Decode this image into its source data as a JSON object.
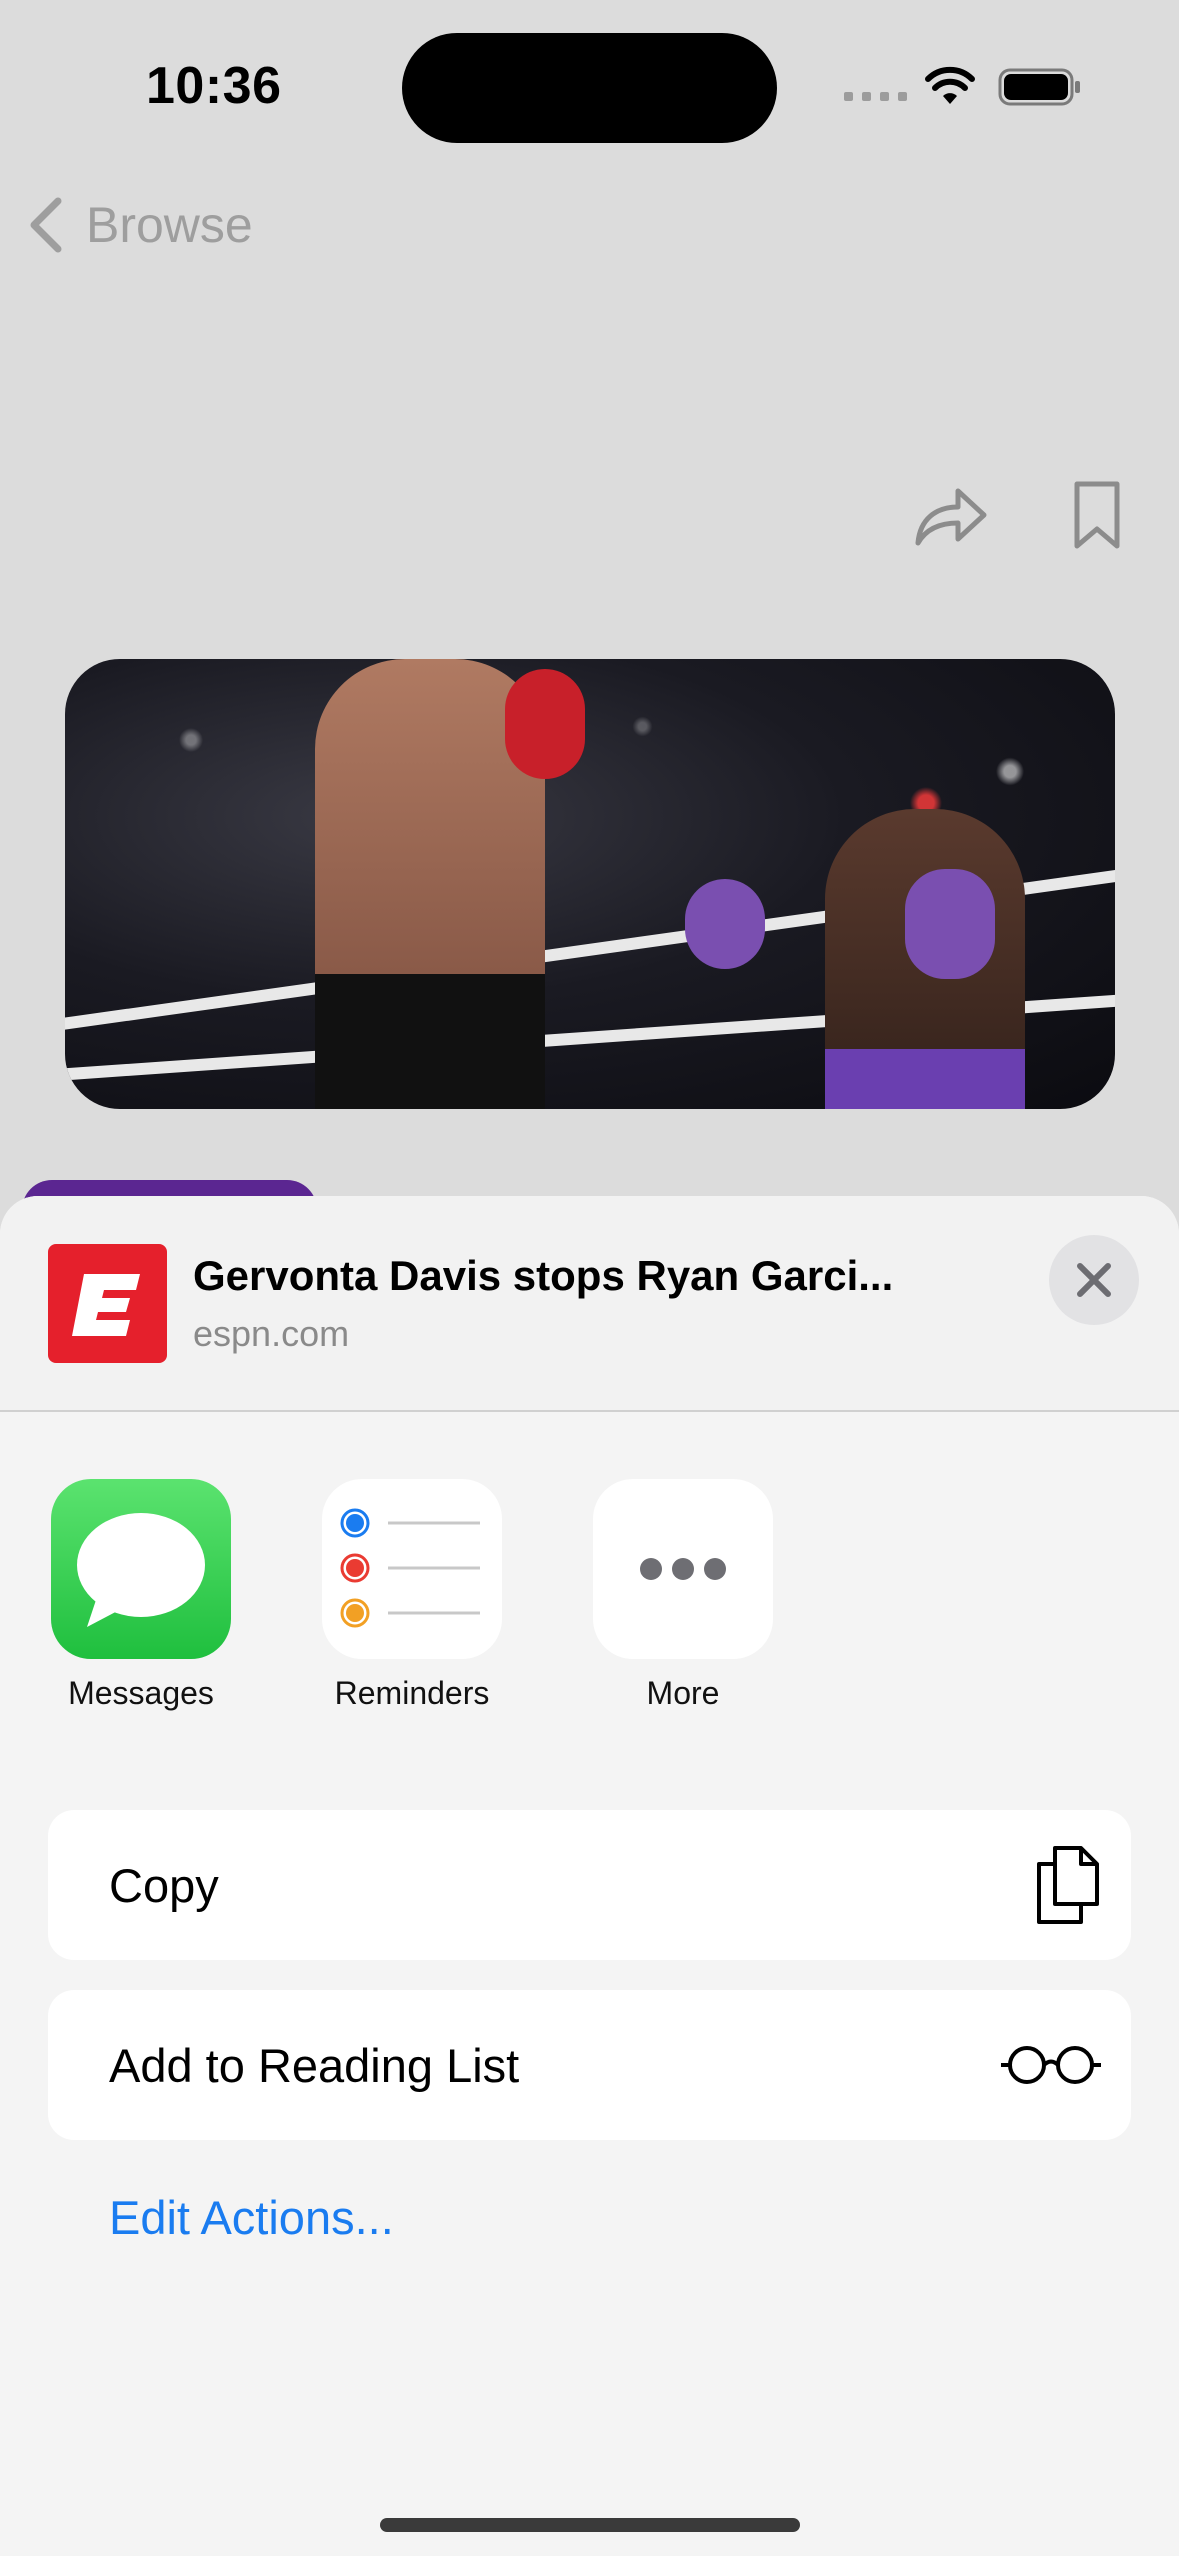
{
  "status_bar": {
    "time": "10:36"
  },
  "nav": {
    "back_label": "Browse"
  },
  "share_sheet": {
    "title": "Gervonta Davis stops Ryan Garci...",
    "subtitle": "espn.com",
    "apps": [
      {
        "label": "Messages",
        "icon": "messages-icon"
      },
      {
        "label": "Reminders",
        "icon": "reminders-icon"
      },
      {
        "label": "More",
        "icon": "more-icon"
      }
    ],
    "actions": [
      {
        "label": "Copy",
        "icon": "copy-icon"
      },
      {
        "label": "Add to Reading List",
        "icon": "glasses-icon"
      }
    ],
    "edit_actions": "Edit Actions..."
  },
  "colors": {
    "accent": "#1a7cf0",
    "espn_red": "#e5202c",
    "messages_green": "#34c759",
    "sheet_bg": "#f4f4f4"
  }
}
